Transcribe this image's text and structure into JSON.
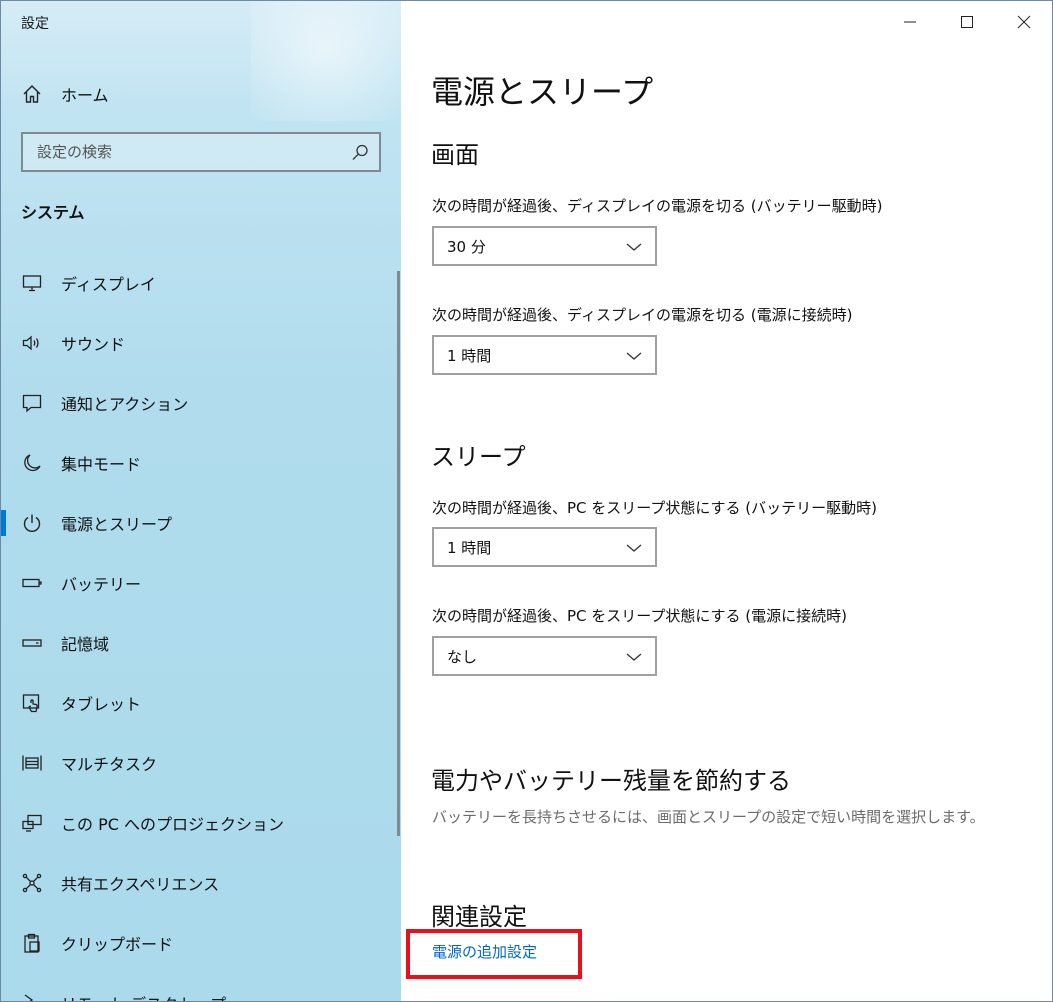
{
  "window": {
    "app_title": "設定",
    "minimize_label": "Minimize",
    "maximize_label": "Maximize",
    "close_label": "Close"
  },
  "sidebar": {
    "home": {
      "label": "ホーム",
      "icon": "home-icon"
    },
    "search": {
      "placeholder": "設定の検索",
      "icon": "search-icon"
    },
    "section": "システム",
    "items": [
      {
        "label": "ディスプレイ",
        "icon": "display-icon"
      },
      {
        "label": "サウンド",
        "icon": "speaker-icon"
      },
      {
        "label": "通知とアクション",
        "icon": "notification-icon"
      },
      {
        "label": "集中モード",
        "icon": "moon-icon"
      },
      {
        "label": "電源とスリープ",
        "icon": "power-icon",
        "active": true
      },
      {
        "label": "バッテリー",
        "icon": "battery-icon"
      },
      {
        "label": "記憶域",
        "icon": "storage-icon"
      },
      {
        "label": "タブレット",
        "icon": "tablet-icon"
      },
      {
        "label": "マルチタスク",
        "icon": "multitask-icon"
      },
      {
        "label": "この PC へのプロジェクション",
        "icon": "projection-icon"
      },
      {
        "label": "共有エクスペリエンス",
        "icon": "shared-experience-icon"
      },
      {
        "label": "クリップボード",
        "icon": "clipboard-icon"
      },
      {
        "label": "リモート デスクトップ",
        "icon": "remote-desktop-icon"
      }
    ]
  },
  "main": {
    "title": "電源とスリープ",
    "screen": {
      "heading": "画面",
      "battery_label": "次の時間が経過後、ディスプレイの電源を切る (バッテリー駆動時)",
      "battery_value": "30 分",
      "plugged_label": "次の時間が経過後、ディスプレイの電源を切る (電源に接続時)",
      "plugged_value": "1 時間"
    },
    "sleep": {
      "heading": "スリープ",
      "battery_label": "次の時間が経過後、PC をスリープ状態にする (バッテリー駆動時)",
      "battery_value": "1 時間",
      "plugged_label": "次の時間が経過後、PC をスリープ状態にする (電源に接続時)",
      "plugged_value": "なし"
    },
    "save": {
      "heading": "電力やバッテリー残量を節約する",
      "description": "バッテリーを長持ちさせるには、画面とスリープの設定で短い時間を選択します。"
    },
    "related": {
      "heading": "関連設定",
      "link": "電源の追加設定"
    }
  },
  "colors": {
    "accent": "#0078d7",
    "link": "#0067c0",
    "highlight": "#e8101b"
  }
}
